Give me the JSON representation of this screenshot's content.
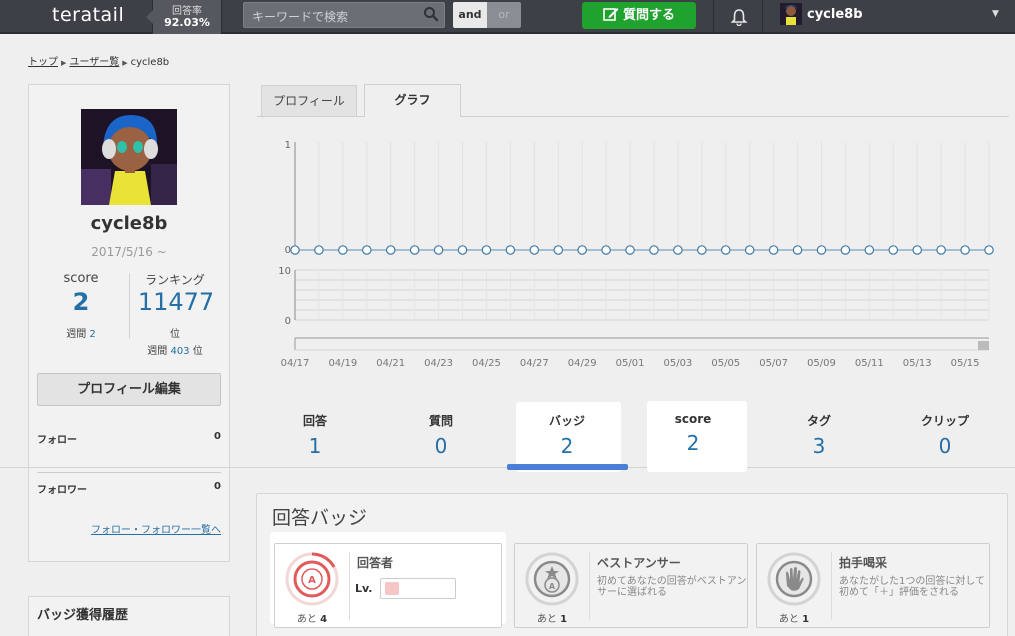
{
  "header": {
    "logo": "teratail",
    "answer_rate_label": "回答率",
    "answer_rate_value": "92.03%",
    "search_placeholder": "キーワードで検索",
    "and_label": "and",
    "or_label": "or",
    "ask_label": "質問する",
    "username": "cycle8b"
  },
  "breadcrumb": [
    "トップ",
    "ユーザー覧",
    "cycle8b"
  ],
  "profile": {
    "name": "cycle8b",
    "joined": "2017/5/16 ~",
    "score_label": "score",
    "score_value": "2",
    "weekly_label": "週間",
    "weekly_score": "2",
    "ranking_label": "ランキング",
    "ranking_value": "11477",
    "ranking_unit": "位",
    "weekly_rank": "403",
    "weekly_rank_unit": "位",
    "edit_label": "プロフィール編集",
    "follow_label": "フォロー",
    "follow_count": "0",
    "follower_label": "フォロワー",
    "follower_count": "0",
    "follow_list_link": "フォロー・フォロワー一覧へ",
    "badge_history_title": "バッジ獲得履歴"
  },
  "tabs": [
    {
      "label": "プロフィール",
      "active": false
    },
    {
      "label": "グラフ",
      "active": true
    }
  ],
  "chart_data": {
    "type": "line",
    "x": [
      "04/17",
      "04/18",
      "04/19",
      "04/20",
      "04/21",
      "04/22",
      "04/23",
      "04/24",
      "04/25",
      "04/26",
      "04/27",
      "04/28",
      "04/29",
      "04/30",
      "05/01",
      "05/02",
      "05/03",
      "05/04",
      "05/05",
      "05/06",
      "05/07",
      "05/08",
      "05/09",
      "05/10",
      "05/11",
      "05/12",
      "05/13",
      "05/14",
      "05/15",
      "05/16"
    ],
    "x_tick_labels": [
      "04/17",
      "04/19",
      "04/21",
      "04/23",
      "04/25",
      "04/27",
      "04/29",
      "05/01",
      "05/03",
      "05/05",
      "05/07",
      "05/09",
      "05/11",
      "05/13",
      "05/15"
    ],
    "series": [
      {
        "values": [
          0,
          0,
          0,
          0,
          0,
          0,
          0,
          0,
          0,
          0,
          0,
          0,
          0,
          0,
          0,
          0,
          0,
          0,
          0,
          0,
          0,
          0,
          0,
          0,
          0,
          0,
          0,
          0,
          0,
          0
        ]
      }
    ],
    "y_ticks_top": [
      "1",
      "0"
    ],
    "ylim_top": [
      0,
      1
    ],
    "y_ticks_bottom": [
      "10",
      "0"
    ],
    "ylim_bottom": [
      0,
      10
    ],
    "bars_bottom": [
      0,
      0,
      0,
      0,
      0,
      0,
      0,
      0,
      0,
      0,
      0,
      0,
      0,
      0,
      0,
      0,
      0,
      0,
      0,
      0,
      0,
      0,
      0,
      0,
      0,
      0,
      0,
      0,
      0,
      0
    ],
    "grid": true
  },
  "stats": [
    {
      "label": "回答",
      "value": "1"
    },
    {
      "label": "質問",
      "value": "0"
    },
    {
      "label": "バッジ",
      "value": "2"
    },
    {
      "label": "score",
      "value": "2"
    },
    {
      "label": "タグ",
      "value": "3"
    },
    {
      "label": "クリップ",
      "value": "0"
    }
  ],
  "badges": {
    "title": "回答バッジ",
    "items": [
      {
        "name": "回答者",
        "desc": "",
        "remain_prefix": "あと",
        "remain": "4",
        "lv_label": "Lv.",
        "progress": 0.2,
        "icon": "a-badge-icon"
      },
      {
        "name": "ベストアンサー",
        "desc": "初めてあなたの回答がベストアンサーに選ばれる",
        "remain_prefix": "あと",
        "remain": "1",
        "icon": "best-answer-badge-icon"
      },
      {
        "name": "拍手喝采",
        "desc": "あなたがした1つの回答に対して初めて「＋」評価をされる",
        "remain_prefix": "あと",
        "remain": "1",
        "icon": "clap-badge-icon"
      }
    ]
  },
  "colors": {
    "header_bg": "#3d4147",
    "accent_green": "#1fa22e",
    "link_blue": "#246fa6",
    "badge_red": "#e05a5a"
  }
}
